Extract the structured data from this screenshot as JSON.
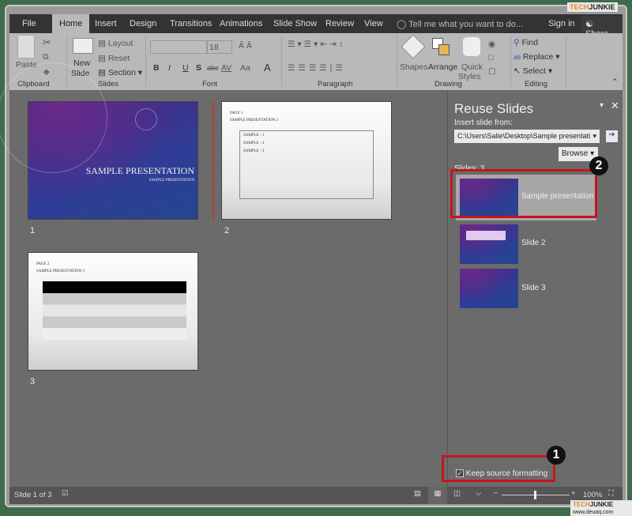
{
  "tabs": [
    "File",
    "Home",
    "Insert",
    "Design",
    "Transitions",
    "Animations",
    "Slide Show",
    "Review",
    "View"
  ],
  "tell_me": "Tell me what you want to do...",
  "sign_in": "Sign in",
  "share": "Share",
  "watermark": {
    "brand_a": "TECH",
    "brand_b": "JUNKIE",
    "url": "www.deuaq.com"
  },
  "ribbon": {
    "clipboard": {
      "paste": "Paste",
      "label": "Clipboard"
    },
    "slides": {
      "new_slide_1": "New",
      "new_slide_2": "Slide",
      "layout": "Layout",
      "reset": "Reset",
      "section": "Section",
      "label": "Slides"
    },
    "font": {
      "font_name": "",
      "font_size": "18",
      "bold": "B",
      "italic": "I",
      "underline": "U",
      "shadow": "S",
      "strike": "abc",
      "spacing": "AV",
      "case": "Aa",
      "color": "A",
      "label": "Font"
    },
    "paragraph": {
      "label": "Paragraph"
    },
    "drawing": {
      "shapes": "Shapes",
      "arrange": "Arrange",
      "quick1": "Quick",
      "quick2": "Styles",
      "label": "Drawing"
    },
    "editing": {
      "find": "Find",
      "replace": "Replace",
      "select": "Select",
      "label": "Editing"
    }
  },
  "slides": [
    {
      "number": "1",
      "title": "SAMPLE PRESENTATION",
      "subtitle": "SAMPLE PRESENTATION"
    },
    {
      "number": "2",
      "heading": "PAGE 1",
      "title": "SAMPLE PRESENTATION 2",
      "bullets": [
        "SAMPLE - 1",
        "SAMPLE - 2",
        "SAMPLE - 3"
      ]
    },
    {
      "number": "3",
      "heading": "PAGE 2",
      "title": "SAMPLE PRESENTATION 3"
    }
  ],
  "reuse_pane": {
    "title": "Reuse Slides",
    "insert_from": "Insert slide from:",
    "path": "C:\\Users\\Salie\\Desktop\\Sample presentati",
    "browse": "Browse",
    "count": "Slides: 3",
    "items": [
      {
        "label": "Sample presentation",
        "selected": true
      },
      {
        "label": "Slide 2"
      },
      {
        "label": "Slide 3"
      }
    ],
    "keep_source": "Keep source formatting",
    "keep_source_checked": true
  },
  "badges": [
    "1",
    "2"
  ],
  "status": {
    "slide_info": "Slide 1 of 3",
    "zoom": "100%",
    "zoom_level": 100
  },
  "colors": {
    "highlight": "#c4161c",
    "accent_orange": "#e08a1e"
  }
}
